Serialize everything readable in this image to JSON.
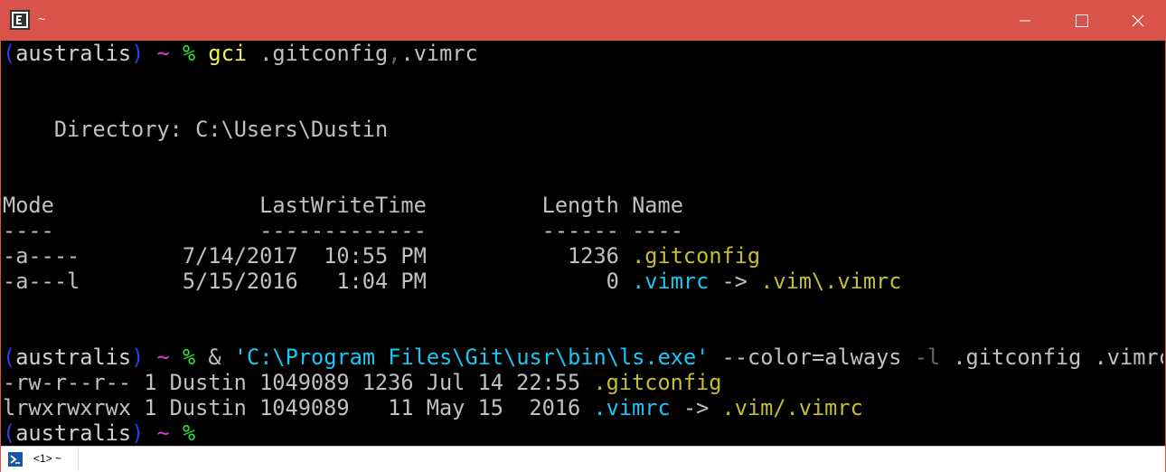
{
  "window": {
    "title": "~",
    "title_bar_color": "#d9534a"
  },
  "status_bar": {
    "tab_label": "<1> ~"
  },
  "terminal": {
    "colors": {
      "background": "#000000",
      "foreground": "#c0c0c0"
    },
    "prompt": {
      "open_paren": "(",
      "host": "australis",
      "close_paren": ")",
      "tilde": "~",
      "symbol": "%"
    },
    "cmd1": {
      "name": "gci",
      "arg1": ".gitconfig",
      "sep": ",",
      "arg2": ".vimrc"
    },
    "directory_line": "Directory: C:\\Users\\Dustin",
    "table": {
      "headers": {
        "mode": "Mode",
        "lastwritetime": "LastWriteTime",
        "length": "Length",
        "name": "Name"
      },
      "underlines": {
        "mode": "----",
        "lastwritetime": "-------------",
        "length": "------",
        "name": "----"
      },
      "rows": [
        {
          "mode": "-a----",
          "date": "7/14/2017",
          "time": "10:55 PM",
          "length": "1236",
          "name": ".gitconfig"
        },
        {
          "mode": "-a---l",
          "date": "5/15/2016",
          "time": "1:04 PM",
          "length": "0",
          "name": ".vimrc",
          "arrow": "->",
          "target": ".vim\\.vimrc"
        }
      ]
    },
    "cmd2": {
      "amp": "&",
      "path": "'C:\\Program Files\\Git\\usr\\bin\\ls.exe'",
      "flag_color": "--color=always",
      "flag_l": "-l",
      "args": ".gitconfig .vimrc"
    },
    "ls_rows": [
      {
        "prefix": "-rw-r--r-- 1 Dustin 1049089 1236 Jul 14 22:55",
        "name": ".gitconfig"
      },
      {
        "prefix": "lrwxrwxrwx 1 Dustin 1049089   11 May 15  2016",
        "name": ".vimrc",
        "arrow": "->",
        "target": ".vim/.vimrc"
      }
    ]
  }
}
